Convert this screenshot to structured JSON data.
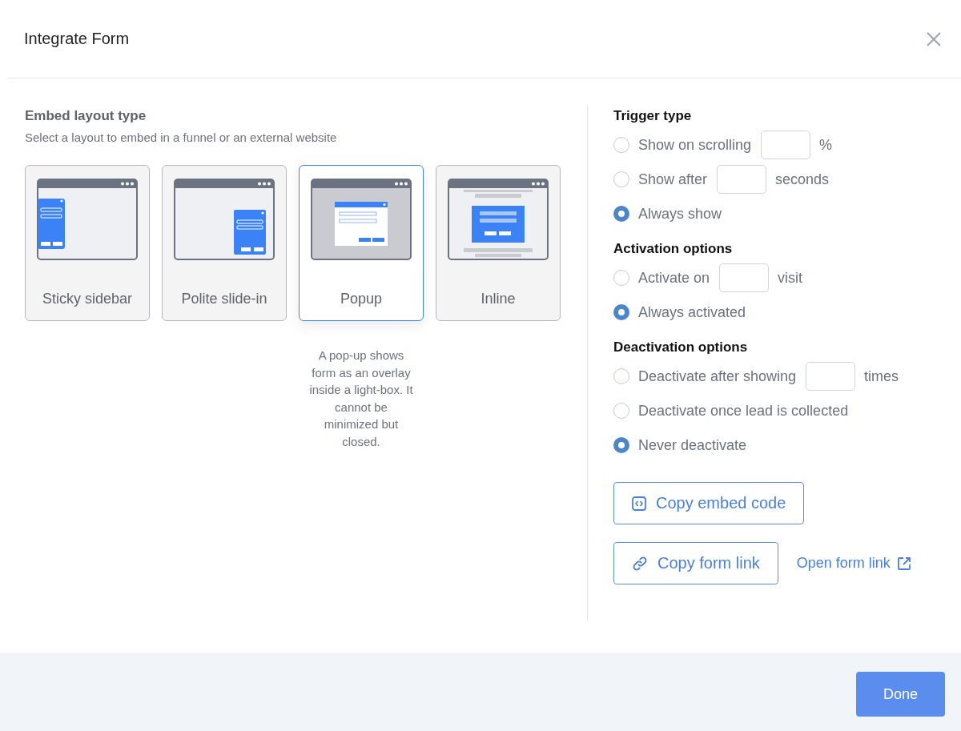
{
  "dialog": {
    "title": "Integrate Form"
  },
  "embed": {
    "heading": "Embed layout type",
    "subtitle": "Select a layout to embed in a funnel or an external website",
    "layouts": [
      {
        "kind": "sidebar",
        "label": "Sticky sidebar",
        "selected": false
      },
      {
        "kind": "slide-in",
        "label": "Polite slide-in",
        "selected": false
      },
      {
        "kind": "popup",
        "label": "Popup",
        "selected": true
      },
      {
        "kind": "inline",
        "label": "Inline",
        "selected": false
      }
    ],
    "description": "A pop-up shows form as an overlay inside a light-box. It cannot be minimized but closed."
  },
  "option_groups": [
    {
      "heading": "Trigger type",
      "options": [
        {
          "kind": "input",
          "label": "Show on scrolling",
          "suffix": "%",
          "selected": false
        },
        {
          "kind": "input",
          "label": "Show after",
          "suffix": "seconds",
          "selected": false
        },
        {
          "kind": "plain",
          "label": "Always show",
          "selected": true
        }
      ]
    },
    {
      "heading": "Activation options",
      "options": [
        {
          "kind": "input",
          "label": "Activate on",
          "suffix": "visit",
          "selected": false
        },
        {
          "kind": "plain",
          "label": "Always activated",
          "selected": true
        }
      ]
    },
    {
      "heading": "Deactivation options",
      "options": [
        {
          "kind": "input",
          "label": "Deactivate after showing",
          "suffix": "times",
          "selected": false
        },
        {
          "kind": "plain",
          "label": "Deactivate once lead is collected",
          "selected": false
        },
        {
          "kind": "plain",
          "label": "Never deactivate",
          "selected": true
        }
      ]
    }
  ],
  "actions": {
    "copy_embed_code": "Copy embed code",
    "copy_form_link": "Copy form link",
    "open_form_link": "Open form link"
  },
  "done": "Done"
}
